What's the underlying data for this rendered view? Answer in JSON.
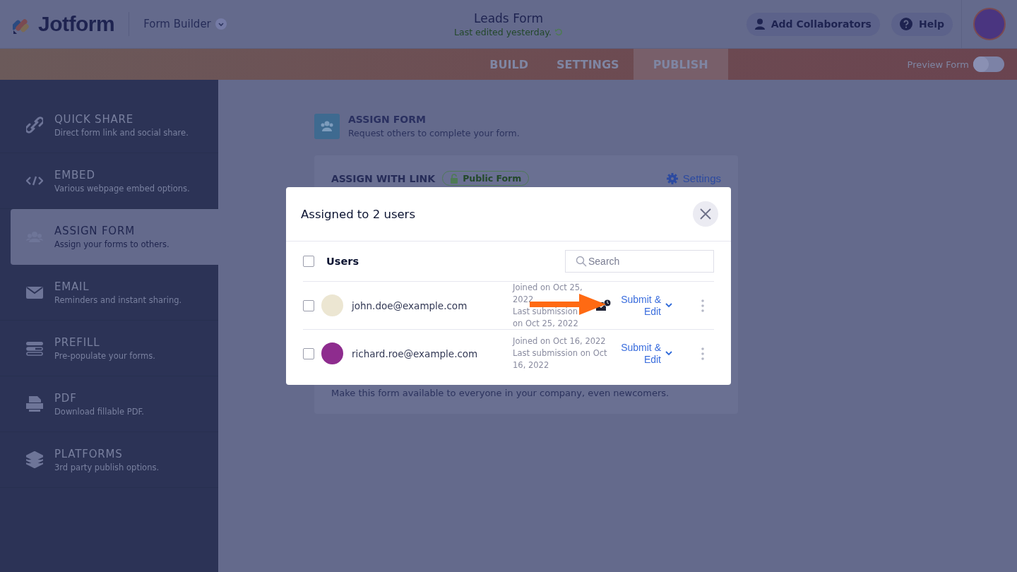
{
  "header": {
    "logo": "Jotform",
    "builder_menu": "Form Builder",
    "form_title": "Leads Form",
    "last_edited": "Last edited yesterday.",
    "buttons": [
      {
        "label": "Add Collaborators",
        "kind": "collaborators"
      },
      {
        "label": "Help",
        "kind": "help"
      }
    ]
  },
  "tabs": [
    {
      "label": "BUILD",
      "selected": false
    },
    {
      "label": "SETTINGS",
      "selected": false
    },
    {
      "label": "PUBLISH",
      "selected": true
    }
  ],
  "preview": {
    "label": "Preview Form",
    "on": false
  },
  "sidebar": {
    "items": [
      {
        "title": "QUICK SHARE",
        "subtitle": "Direct form link and social share.",
        "selected": false
      },
      {
        "title": "EMBED",
        "subtitle": "Various webpage embed options.",
        "selected": false
      },
      {
        "title": "ASSIGN FORM",
        "subtitle": "Assign your forms to others.",
        "selected": true
      },
      {
        "title": "EMAIL",
        "subtitle": "Reminders and instant sharing.",
        "selected": false
      },
      {
        "title": "PREFILL",
        "subtitle": "Pre-populate your forms.",
        "selected": false
      },
      {
        "title": "PDF",
        "subtitle": "Download fillable PDF.",
        "selected": false
      },
      {
        "title": "PLATFORMS",
        "subtitle": "3rd party publish options.",
        "selected": false
      }
    ]
  },
  "section": {
    "title": "ASSIGN FORM",
    "subtitle": "Request others to complete your form."
  },
  "card": {
    "title": "ASSIGN WITH LINK",
    "badge": "Public Form",
    "settings": "Settings",
    "note": "Make this form available to everyone in your company, even newcomers."
  },
  "modal": {
    "title": "Assigned to 2 users",
    "column": "Users",
    "all_checked": false,
    "search": {
      "placeholder": "Search"
    },
    "rows": [
      {
        "email": "john.doe@example.com",
        "joined": "Joined on Oct 25, 2022",
        "last_submission": "Last submission on Oct 25, 2022",
        "checked": false,
        "reminder": true,
        "permission": "Submit & Edit",
        "color": "#ece6d2"
      },
      {
        "email": "richard.roe@example.com",
        "joined": "Joined on Oct 16, 2022",
        "last_submission": "Last submission on Oct 16, 2022",
        "checked": false,
        "reminder": false,
        "permission": "Submit & Edit",
        "color": "#8e2c8e"
      }
    ]
  }
}
